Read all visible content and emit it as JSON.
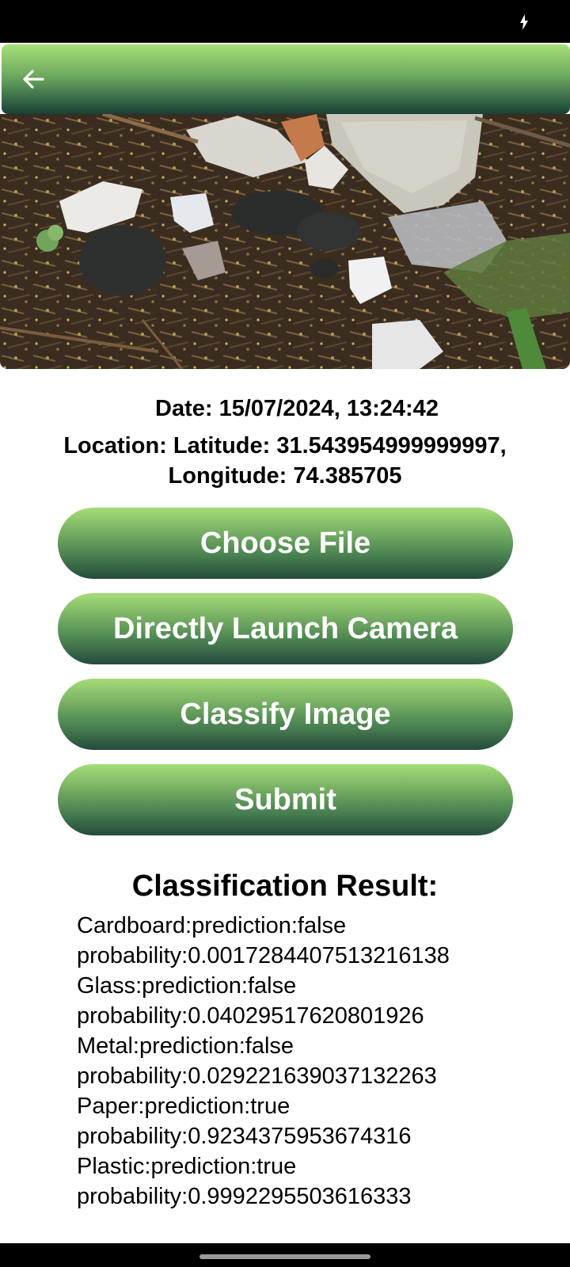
{
  "status_bar": {
    "charging_icon": "bolt-icon"
  },
  "app_bar": {
    "back_icon": "arrow-left-icon",
    "color": "#6ea95e"
  },
  "photo": {
    "description_icon": "waste-photo"
  },
  "info": {
    "date": "Date: 15/07/2024, 13:24:42",
    "location_line1": "Location: Latitude: 31.543954999999997,",
    "location_line2": "Longitude: 74.385705"
  },
  "buttons": {
    "choose_file": "Choose File",
    "launch_camera": "Directly Launch Camera",
    "classify": "Classify Image",
    "submit": "Submit"
  },
  "result": {
    "title": "Classification Result:",
    "lines": [
      "Cardboard:prediction:false",
      "probability:0.0017284407513216138",
      "Glass:prediction:false",
      "probability:0.04029517620801926",
      "Metal:prediction:false",
      "probability:0.029221639037132263",
      "Paper:prediction:true",
      "probability:0.9234375953674316",
      "Plastic:prediction:true",
      "probability:0.9992295503616333"
    ]
  }
}
